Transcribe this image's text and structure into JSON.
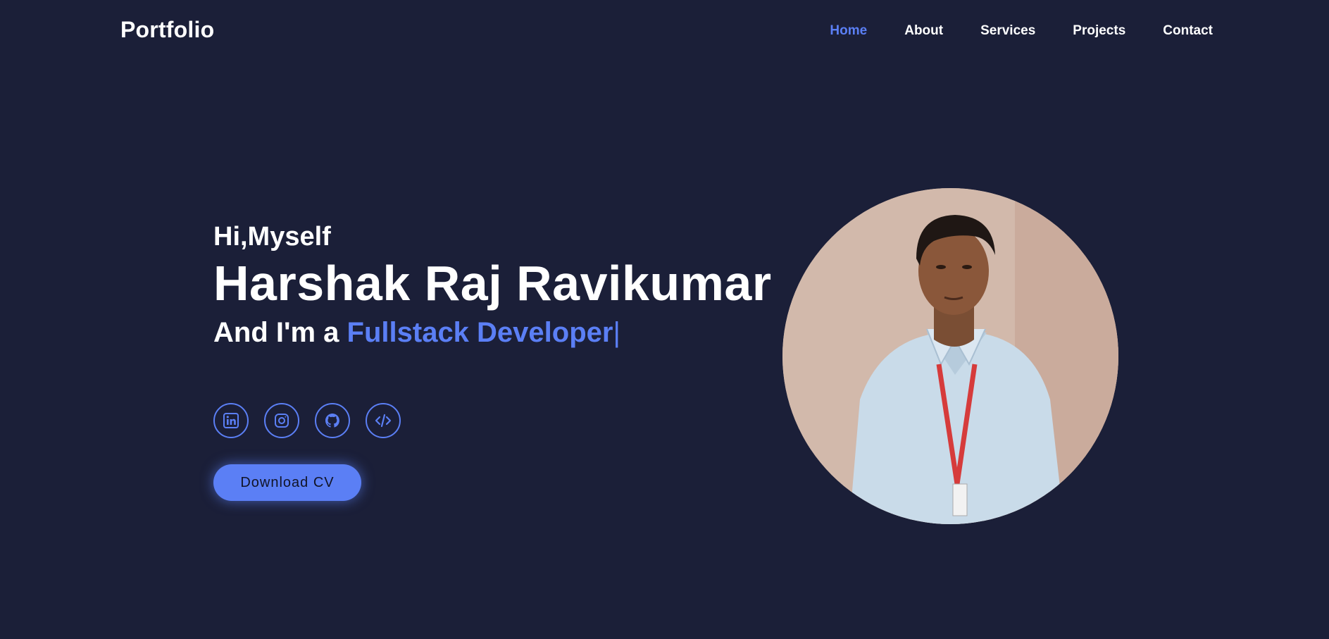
{
  "header": {
    "logo": "Portfolio",
    "nav": [
      {
        "label": "Home",
        "active": true
      },
      {
        "label": "About",
        "active": false
      },
      {
        "label": "Services",
        "active": false
      },
      {
        "label": "Projects",
        "active": false
      },
      {
        "label": "Contact",
        "active": false
      }
    ]
  },
  "hero": {
    "greeting": "Hi,Myself",
    "name": "Harshak Raj Ravikumar",
    "role_prefix": "And I'm a ",
    "role_highlight": "Fullstack Developer",
    "cursor": "|",
    "socials": [
      {
        "icon": "linkedin-icon"
      },
      {
        "icon": "instagram-icon"
      },
      {
        "icon": "github-icon"
      },
      {
        "icon": "code-icon"
      }
    ],
    "cv_button": "Download CV"
  },
  "colors": {
    "background": "#1b1f38",
    "accent": "#5b7ff5",
    "text": "#ffffff"
  }
}
